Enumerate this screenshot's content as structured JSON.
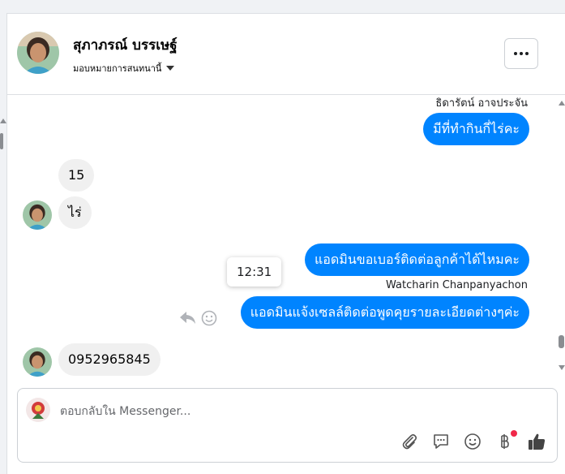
{
  "header": {
    "contact_name": "สุภาภรณ์ บรรเษฐ์",
    "assign_label": "มอบหมายการสนทนานี้"
  },
  "messages": [
    {
      "id": "m1",
      "direction": "outgoing",
      "sender": "ธิดารัตน์ อาจประจัน",
      "text": "มีที่ทำกินกี่ไร่คะ"
    },
    {
      "id": "m2",
      "direction": "incoming",
      "text": "15"
    },
    {
      "id": "m3",
      "direction": "incoming",
      "text": "ไร่"
    },
    {
      "id": "m4",
      "direction": "outgoing",
      "text": "แอดมินขอเบอร์ติดต่อลูกค้าได้ไหมคะ"
    },
    {
      "id": "m5",
      "direction": "outgoing",
      "sender": "Watcharin Chanpanyachon",
      "text": "แอดมินแจ้งเซลล์ติดต่อพูดคุยรายละเอียดต่างๆค่ะ",
      "tooltip_time": "12:31"
    },
    {
      "id": "m6",
      "direction": "incoming",
      "text": "0952965845"
    }
  ],
  "composer": {
    "placeholder": "ตอบกลับใน Messenger...",
    "value": ""
  },
  "colors": {
    "outgoing_bubble": "#0084ff",
    "incoming_bubble": "#f0f0f0",
    "notification_dot": "#f02849"
  },
  "icons": [
    "more-options-icon",
    "chevron-down-icon",
    "reply-icon",
    "emoji-react-icon",
    "attachment-icon",
    "saved-replies-icon",
    "emoji-icon",
    "payment-icon",
    "like-icon"
  ]
}
